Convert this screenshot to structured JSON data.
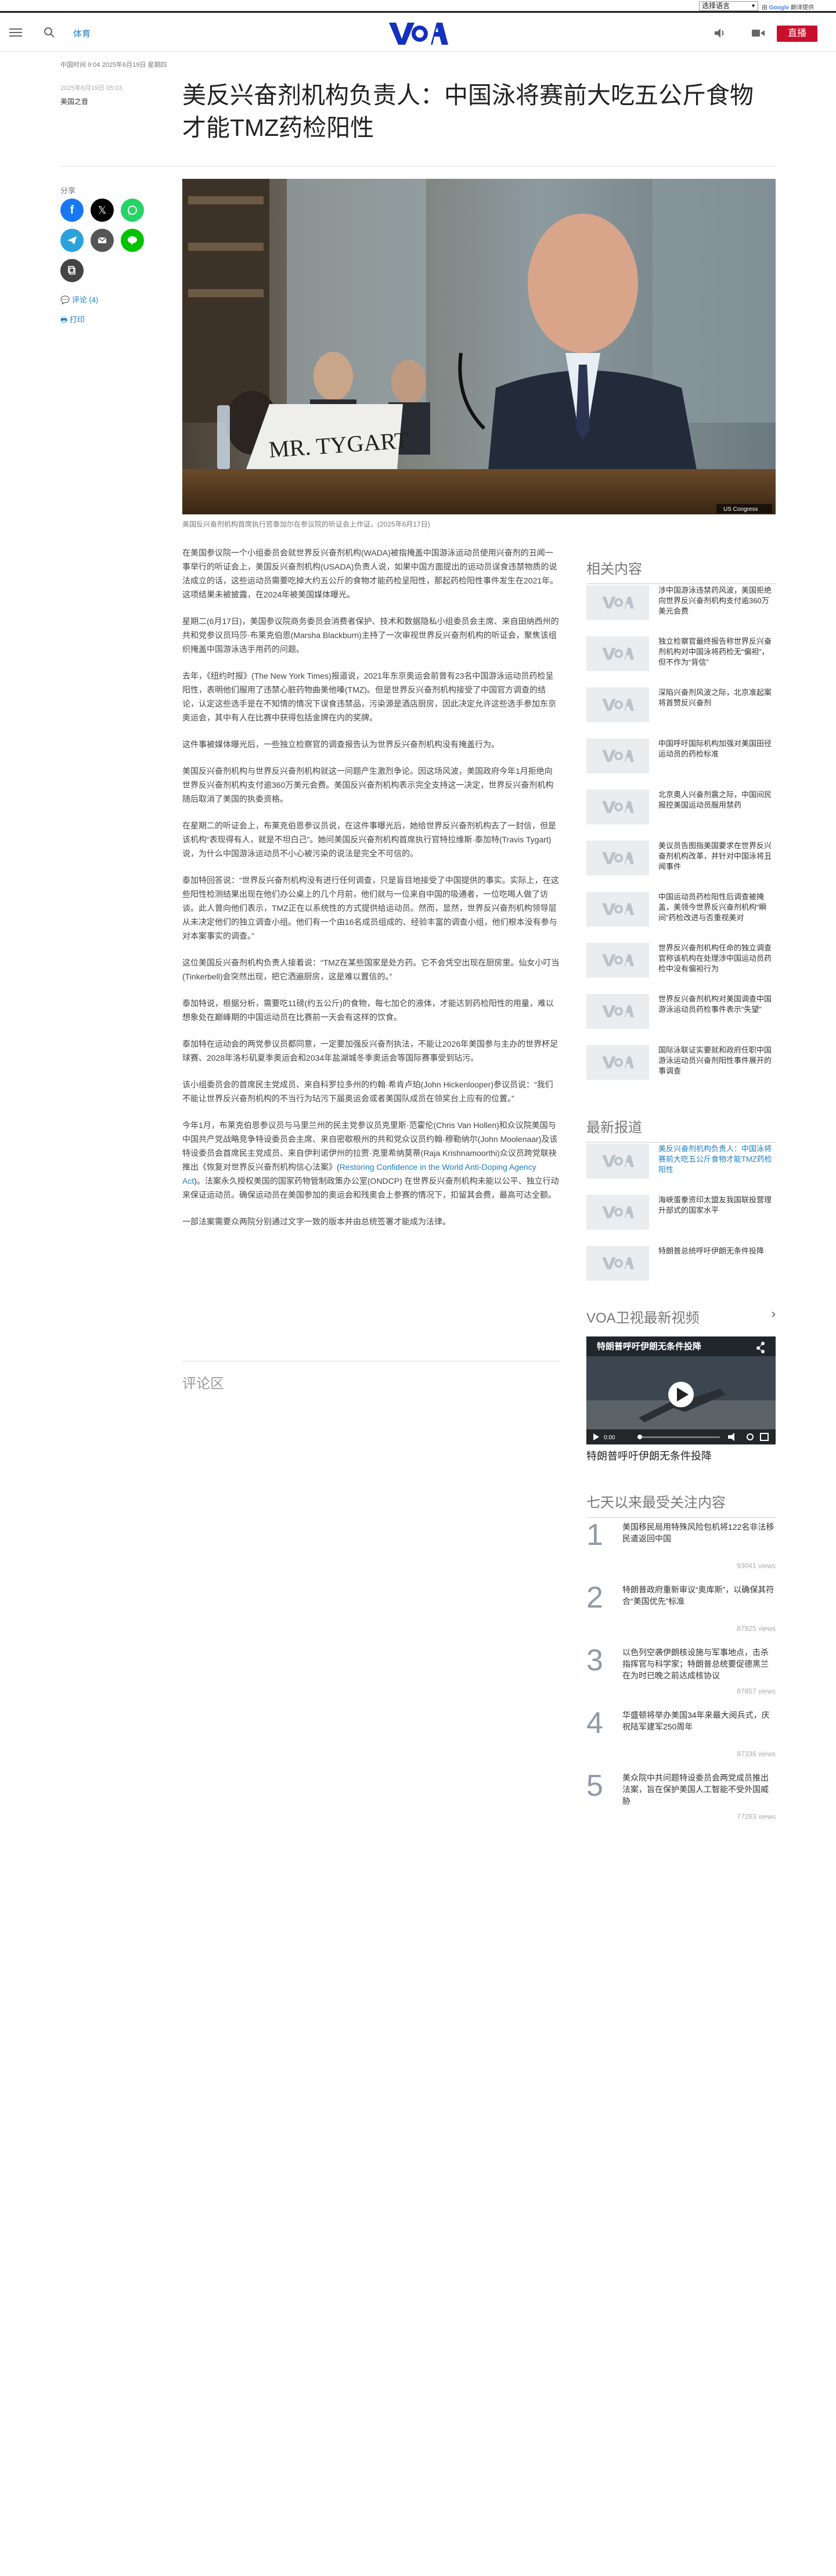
{
  "top_bar": {
    "language_select": "选择语言",
    "powered_prefix": "由",
    "powered_brand": "Google",
    "powered_suffix": "翻译提供"
  },
  "header": {
    "section_link": "体育",
    "logo_text": "VOA",
    "live_label": "直播"
  },
  "article": {
    "dateline": "中国时间 9:04 2025年6月19日 星期四",
    "pubdate": "2025年6月19日 05:03",
    "author": "美国之音",
    "title": "美反兴奋剂机构负责人：中国泳将赛前大吃五公斤食物才能TMZ药检阳性",
    "share_label": "分享",
    "comments_link": "评论 (4)",
    "print_link": "打印",
    "image_caption": "美国反兴奋剂机构首席执行官泰加尔在参议院的听证会上作证。(2025年6月17日)",
    "image_credit": "US Congress",
    "nameplate": "MR. TYGART",
    "paragraphs": [
      "在美国参议院一个小组委员会就世界反兴奋剂机构(WADA)被指掩盖中国游泳运动员使用兴奋剂的丑闻一事举行的听证会上，美国反兴奋剂机构(USADA)负责人说，如果中国方面提出的运动员误食违禁物质的说法成立的话，这些运动员需要吃掉大约五公斤的食物才能药检呈阳性，那起药检阳性事件发生在2021年。这项结果未被披露，在2024年被美国媒体曝光。",
      "星期二(6月17日)，美国参议院商务委员会消费者保护、技术和数据隐私小组委员会主席、来自田纳西州的共和党参议员玛莎·布莱克伯恩(Marsha Blackburn)主持了一次审视世界反兴奋剂机构的听证会，聚焦该组织掩盖中国游泳选手用药的问题。",
      "去年，《纽约时报》(The New York Times)报道说，2021年东京奥运会前曾有23名中国游泳运动员药检呈阳性，表明他们服用了违禁心脏药物曲美他嗪(TMZ)。但是世界反兴奋剂机构接受了中国官方调查的结论，认定这些选手是在不知情的情况下误食违禁品，污染源是酒店厨房，因此决定允许这些选手参加东京奥运会，其中有人在比赛中获得包括金牌在内的奖牌。",
      "这件事被媒体曝光后，一些独立检察官的调查报告认为世界反兴奋剂机构没有掩盖行为。",
      "美国反兴奋剂机构与世界反兴奋剂机构就这一问题产生激烈争论。因这场风波，美国政府今年1月拒绝向世界反兴奋剂机构支付逾360万美元会费。美国反兴奋剂机构表示完全支持这一决定，世界反兴奋剂机构随后取消了美国的执委资格。",
      "在星期二的听证会上，布莱克伯恩参议员说，在这件事曝光后，她给世界反兴奋剂机构去了一封信，但是该机构“表现得有人，就是不坦白己”。她问美国反兴奋剂机构首席执行官特拉维斯·泰加特(Travis Tygart)说，为什么中国游泳运动员不小心被污染的说法是完全不可信的。",
      "泰加特回答说：“世界反兴奋剂机构没有进行任何调查，只是盲目地接受了中国提供的事实。实际上，在这些阳性检测结果出现在他们办公桌上的几个月前，他们就与一位来自中国的吸通者，一位吃喝人做了访谈。此人曾向他们表示，TMZ正在以系统性的方式提供给运动员。然而，显然，世界反兴奋剂机构领导层从未决定他们的独立调查小组。他们有一个由16名成员组成的、经验丰富的调查小组，他们根本没有参与对本案事实的调查。”",
      "这位美国反兴奋剂机构负责人接着说：“TMZ在某些国家是处方药。它不会凭空出现在厨房里。仙女小叮当(Tinkerbell)会突然出现，把它洒遍厨房，这是难以置信的。”",
      "泰加特说，根据分析，需要吃11磅(约五公斤)的食物，每七加仑的液体，才能达到药检阳性的用量，难以想象处在巅峰期的中国运动员在比赛前一天会有这样的饮食。",
      "泰加特在运动会的两党参议员都同意，一定要加强反兴奋剂执法，不能让2026年美国参与主办的世界杯足球赛、2028年洛杉矶夏季奥运会和2034年盐湖城冬季奥运会等国际赛事受到玷污。",
      "该小组委员会的首席民主党成员、来自科罗拉多州的约翰·希肯卢珀(John Hickenlooper)参议员说：“我们不能让世界反兴奋剂机构的不当行为玷污下届奥运会或者美国队成员在领奖台上应有的位置。”",
      "今年1月，布莱克伯恩参议员与马里兰州的民主党参议员克里斯·范霍伦(Chris Van Hollen)和众议院美国与中国共产党战略竞争特设委员会主席、来自密歇根州的共和党众议员约翰·穆勒纳尔(John Moolenaar)及该特设委员会首席民主党成员、来自伊利诺伊州的拉贾·克里希纳莫蒂(Raja Krishnamoorthi)众议员跨党联袂推出《恢复对世界反兴奋剂机构信心法案》(",
      "Restoring Confidence in the World Anti-Doping Agency Act",
      ")。法案永久授权美国的国家药物管制政策办公室(ONDCP) 在世界反兴奋剂机构未能以公平、独立行动来保证运动员。确保运动员在美国参加的奥运会和残奥会上参赛的情况下，扣留其会费，最高可达全额。",
      "一部法案需要众两院分别通过文字一致的版本并由总统签署才能成为法律。"
    ]
  },
  "comments": {
    "heading": "评论区"
  },
  "related": {
    "heading": "相关内容",
    "items": [
      "涉中国游泳违禁药风波，美国拒绝向世界反兴奋剂机构支付逾360万美元会费",
      "独立检察官最终报告称世界反兴奋剂机构对中国泳将药检无“偏袒”，但不作为“背信”",
      "深陷兴奋剂风波之际，北京准起案将首赞反兴奋剂",
      "中国呼吁国际机构加强对美国田径运动员的药检标准",
      "北京奥人兴奋剂震之际，中国间民报控美国运动员服用禁药",
      "美议员告图指美国要求在世界反兴奋剂机构改革，并针对中国泳将丑闻事件",
      "中国运动员药检阳性后调查被掩盖，美领今世界反兴奋剂机构“瞬间”药检改进与否重视美对",
      "世界反兴奋剂机构任命的独立调查官称该机构在处理涉中国运动员药检中没有偏袒行为",
      "世界反兴奋剂机构对美国调查中国游泳运动员药检事件表示“失望”",
      "国际泳联证实要就和政府任职中国游泳运动员兴奋剂阳性事件展开的事调查"
    ]
  },
  "latest": {
    "heading": "最新报道",
    "items": [
      "美反兴奋剂机构负责人：中国泳将赛前大吃五公斤食物才能TMZ药检阳性",
      "海峡蛋豢资印太盟友我国联投营理升部式的国家水平",
      "特朗普总统呼吁伊朗无条件投降"
    ]
  },
  "video": {
    "heading": "VOA卫视最新视频",
    "clip_title": "特朗普呼吁伊朗无条件投降",
    "time_display": "0:00",
    "caption": "特朗普呼吁伊朗无条件投降"
  },
  "popular": {
    "heading": "七天以来最受关注内容",
    "items": [
      {
        "num": "1",
        "text": "美国移民局用特殊风险包机将122名非法移民遣返回中国",
        "views": "93041 views"
      },
      {
        "num": "2",
        "text": "特朗普政府重新审议“奥库斯”，以确保其符合“美国优先”标准",
        "views": "87925 views"
      },
      {
        "num": "3",
        "text": "以色列空袭伊朗核设施与军事地点，击杀指挥官与科学家；特朗普总统要促德黑兰在为时已晚之前达成核协议",
        "views": "87857 views"
      },
      {
        "num": "4",
        "text": "华盛顿将举办美国34年来最大阅兵式，庆祝陆军建军250周年",
        "views": "87336 views"
      },
      {
        "num": "5",
        "text": "美众院中共问题特设委员会两党成员推出法案，旨在保护美国人工智能不受外国威胁",
        "views": "77203 views"
      }
    ]
  },
  "colors": {
    "accent": "#1c7fc2",
    "live": "#c8102e",
    "facebook": "#1877f2",
    "x": "#000000",
    "whatsapp": "#25d366",
    "telegram": "#2aa3dd",
    "email": "#555555",
    "line": "#00c300",
    "copy": "#444444"
  }
}
